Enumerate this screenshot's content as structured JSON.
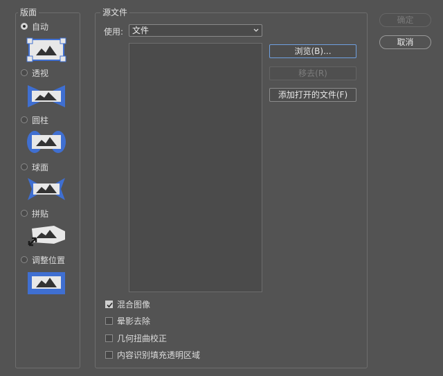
{
  "layout_panel": {
    "title": "版面",
    "options": [
      {
        "label": "自动",
        "checked": true
      },
      {
        "label": "透视",
        "checked": false
      },
      {
        "label": "圆柱",
        "checked": false
      },
      {
        "label": "球面",
        "checked": false
      },
      {
        "label": "拼贴",
        "checked": false
      },
      {
        "label": "调整位置",
        "checked": false
      }
    ]
  },
  "source_panel": {
    "title": "源文件",
    "use_label": "使用:",
    "use_value": "文件",
    "buttons": {
      "browse": "浏览(B)...",
      "remove": "移去(R)",
      "add_open": "添加打开的文件(F)"
    },
    "checkboxes": [
      {
        "label": "混合图像",
        "checked": true
      },
      {
        "label": "晕影去除",
        "checked": false
      },
      {
        "label": "几何扭曲校正",
        "checked": false
      },
      {
        "label": "内容识别填充透明区域",
        "checked": false
      }
    ]
  },
  "dialog_buttons": {
    "ok": "确定",
    "cancel": "取消"
  },
  "colors": {
    "background": "#535353",
    "accent_blue": "#3f6fd1",
    "focus_border": "#6fa0e0"
  }
}
